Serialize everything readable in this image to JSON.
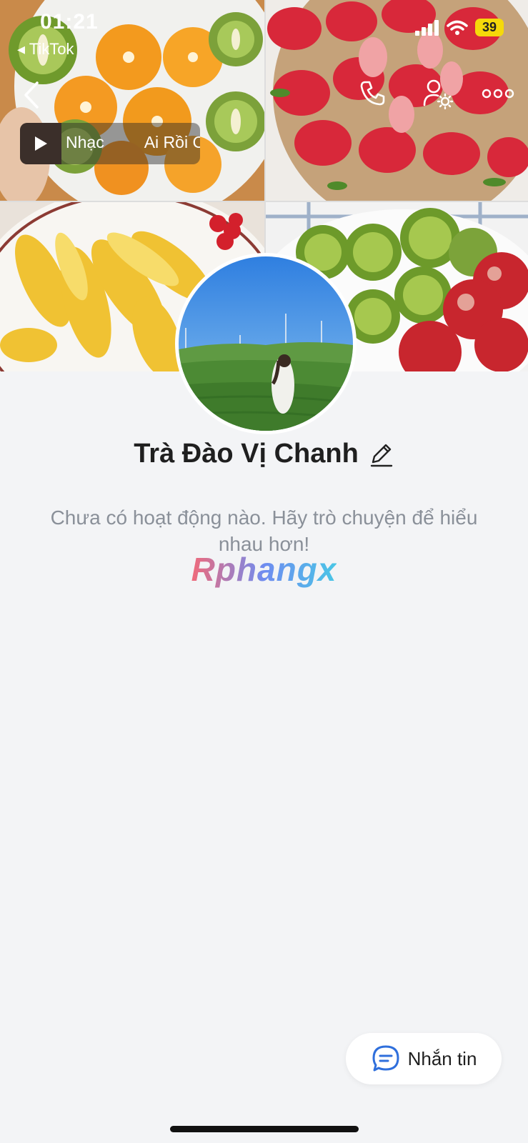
{
  "status_bar": {
    "time": "01:21",
    "back_app": "◂ TikTok",
    "battery": "39"
  },
  "music": {
    "text_1": "Nhạc",
    "text_2": "Ai Rồi C"
  },
  "profile": {
    "name": "Trà Đào Vị Chanh",
    "empty_message": "Chưa có hoạt động nào. Hãy trò chuyện để hiểu nhau hơn!"
  },
  "watermark": "Rphangx",
  "message_button": {
    "label": "Nhắn tin"
  },
  "icons": [
    "back-icon",
    "play-icon",
    "phone-icon",
    "user-settings-icon",
    "more-icon",
    "edit-icon",
    "chat-icon",
    "signal-icon",
    "wifi-icon"
  ],
  "colors": {
    "background": "#f3f4f6",
    "accent": "#2f6fdc",
    "battery": "#f5d90a"
  }
}
